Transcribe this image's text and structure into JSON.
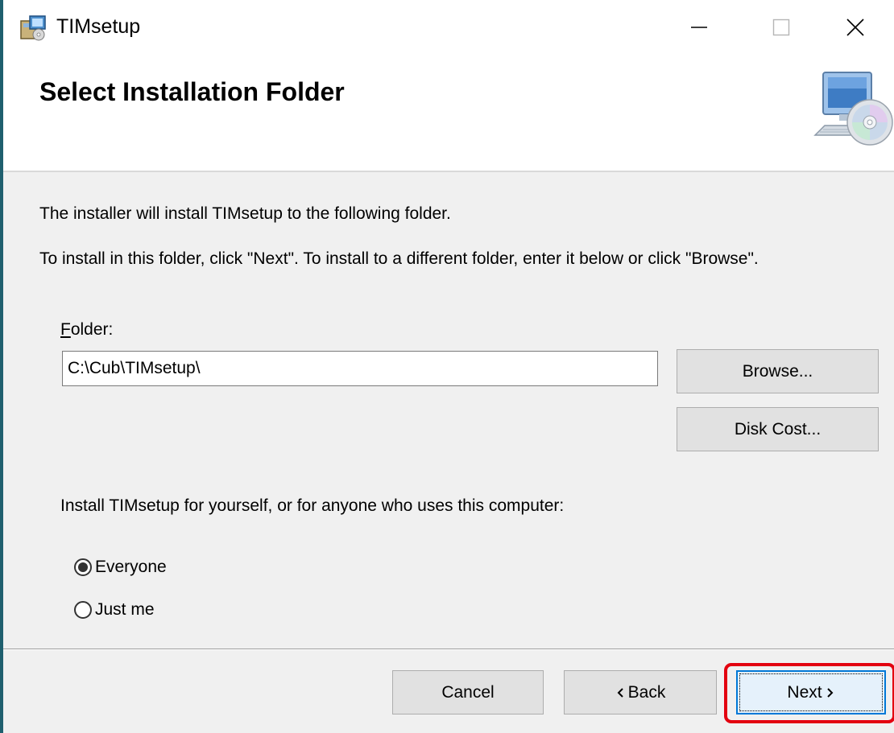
{
  "window": {
    "title": "TIMsetup",
    "controls": [
      "minimize-icon",
      "maximize-icon",
      "close-icon"
    ]
  },
  "banner": {
    "title": "Select Installation Folder",
    "icon": "computer-disc-icon"
  },
  "body": {
    "line1": "The installer will install TIMsetup to the following folder.",
    "line2": "To install in this folder, click \"Next\". To install to a different folder, enter it below or click \"Browse\"."
  },
  "folder": {
    "label_accel": "F",
    "label_rest": "older:",
    "value": "C:\\Cub\\TIMsetup\\",
    "browse_label": "Browse...",
    "disk_cost_label": "Disk Cost..."
  },
  "install_for": {
    "prompt": "Install TIMsetup for yourself, or for anyone who uses this computer:",
    "options": [
      {
        "label": "Everyone",
        "selected": true
      },
      {
        "label": "Just me",
        "selected": false
      }
    ]
  },
  "footer": {
    "cancel_label": "Cancel",
    "back_label": "Back",
    "next_label": "Next"
  },
  "colors": {
    "accent": "#0078d7",
    "highlight": "#e3000f",
    "dialog_bg": "#f0f0f0"
  }
}
